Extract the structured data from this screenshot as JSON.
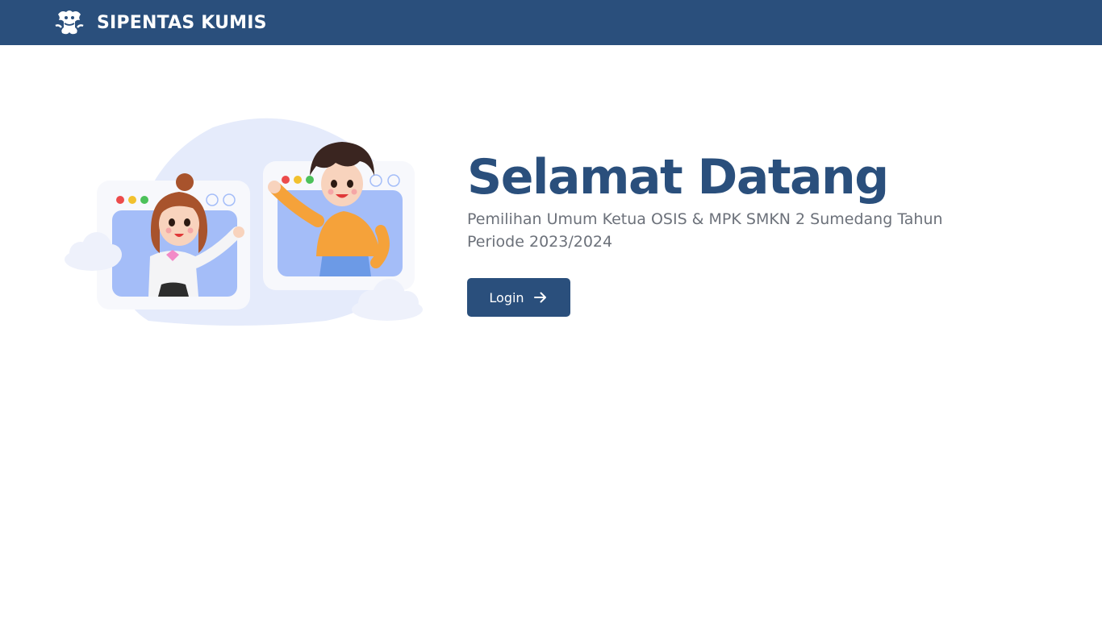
{
  "header": {
    "brand_name": "SIPENTAS KUMIS",
    "logo_icon": "emblem-icon"
  },
  "hero": {
    "title": "Selamat Datang",
    "subtitle": "Pemilihan Umum Ketua OSIS & MPK SMKN 2 Sumedang Tahun Periode 2023/2024",
    "login_label": "Login",
    "login_icon": "arrow-right-icon",
    "illustration": "video-call-illustration"
  },
  "colors": {
    "primary": "#2a4f7c",
    "subtitle_text": "#6c717a",
    "background": "#ffffff",
    "blob": "#e5ebfb",
    "screen": "#a4bdf8"
  }
}
